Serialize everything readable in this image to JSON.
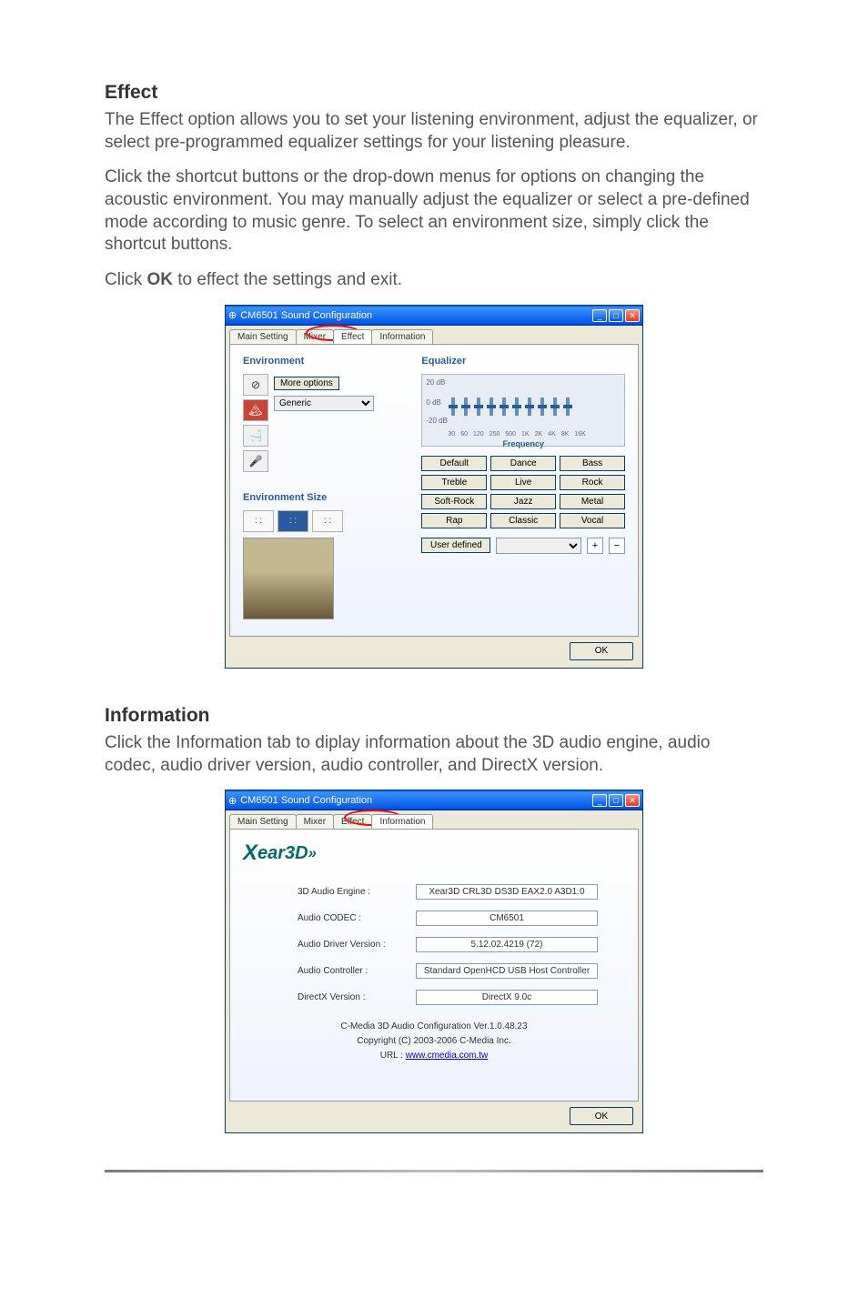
{
  "sections": {
    "effect": {
      "heading": "Effect",
      "para1": "The Effect option allows you to set your listening environment, adjust the equalizer, or select pre-programmed equalizer settings for your listening pleasure.",
      "para2": "Click the shortcut buttons or the drop-down menus for options on changing the acoustic environment. You may manually adjust the equalizer or select a pre-defined mode according to music genre. To select an environment size, simply click the shortcut buttons.",
      "para3_a": "Click ",
      "para3_b": "OK",
      "para3_c": " to effect the settings and exit."
    },
    "information": {
      "heading": "Information",
      "para1": "Click the Information tab to diplay information about the 3D audio engine, audio codec, audio driver version, audio controller, and DirectX version."
    }
  },
  "dialog": {
    "title": "CM6501 Sound Configuration",
    "tabs": [
      "Main Setting",
      "Mixer",
      "Effect",
      "Information"
    ],
    "ok": "OK"
  },
  "effect": {
    "env_title": "Environment",
    "more_options": "More options",
    "env_select": "Generic",
    "env_size_title": "Environment Size",
    "eq_title": "Equalizer",
    "eq_ytop": "20 dB",
    "eq_ymid": "0 dB",
    "eq_ybot": "-20 dB",
    "eq_x": [
      "30",
      "60",
      "120",
      "250",
      "500",
      "1K",
      "2K",
      "4K",
      "8K",
      "16K"
    ],
    "eq_freq": "Frequency",
    "presets": [
      "Default",
      "Dance",
      "Bass",
      "Treble",
      "Live",
      "Rock",
      "Soft-Rock",
      "Jazz",
      "Metal",
      "Rap",
      "Classic",
      "Vocal"
    ],
    "user_defined": "User defined"
  },
  "info": {
    "logo": "ear3D",
    "rows": [
      {
        "label": "3D Audio Engine :",
        "value": "Xear3D CRL3D DS3D EAX2.0 A3D1.0"
      },
      {
        "label": "Audio CODEC :",
        "value": "CM6501"
      },
      {
        "label": "Audio Driver Version :",
        "value": "5.12.02.4219 (72)"
      },
      {
        "label": "Audio Controller :",
        "value": "Standard OpenHCD USB Host Controller"
      },
      {
        "label": "DirectX Version :",
        "value": "DirectX 9.0c"
      }
    ],
    "copyright1": "C-Media 3D Audio Configuration Ver.1.0.48.23",
    "copyright2": "Copyright (C) 2003-2006 C-Media Inc.",
    "url_label": "URL : ",
    "url": "www.cmedia.com.tw"
  }
}
